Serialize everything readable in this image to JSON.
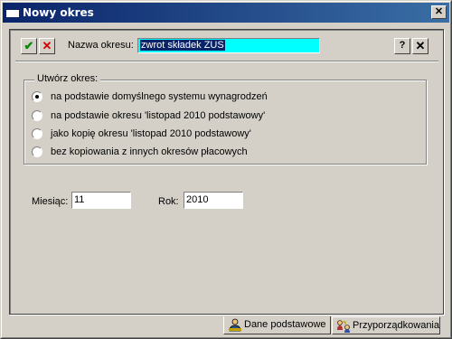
{
  "window": {
    "title": "Nowy okres",
    "close_glyph": "✕"
  },
  "toolbar": {
    "ok_glyph": "✔",
    "cancel_glyph": "✕",
    "name_label": "Nazwa okresu:",
    "name_value": "zwrot składek ZUS",
    "help_glyph": "?",
    "close_glyph": "✕"
  },
  "group": {
    "title": "Utwórz okres:",
    "options": [
      {
        "label": "na podstawie domyślnego systemu wynagrodzeń",
        "selected": true
      },
      {
        "label": "na podstawie okresu 'listopad 2010 podstawowy'",
        "selected": false
      },
      {
        "label": "jako kopię okresu 'listopad 2010 podstawowy'",
        "selected": false
      },
      {
        "label": "bez kopiowania z innych okresów płacowych",
        "selected": false
      }
    ]
  },
  "fields": {
    "month_label": "Miesiąc:",
    "month_value": "11",
    "year_label": "Rok:",
    "year_value": "2010"
  },
  "tabs": [
    {
      "label": "Dane podstawowe",
      "icon": "person-icon"
    },
    {
      "label": "Przyporządkowania",
      "icon": "people-link-icon"
    }
  ],
  "colors": {
    "title_bar": "#0a246a",
    "name_field_bg": "#00ffff",
    "selection": "#0a246a",
    "face": "#d4d0c8"
  }
}
